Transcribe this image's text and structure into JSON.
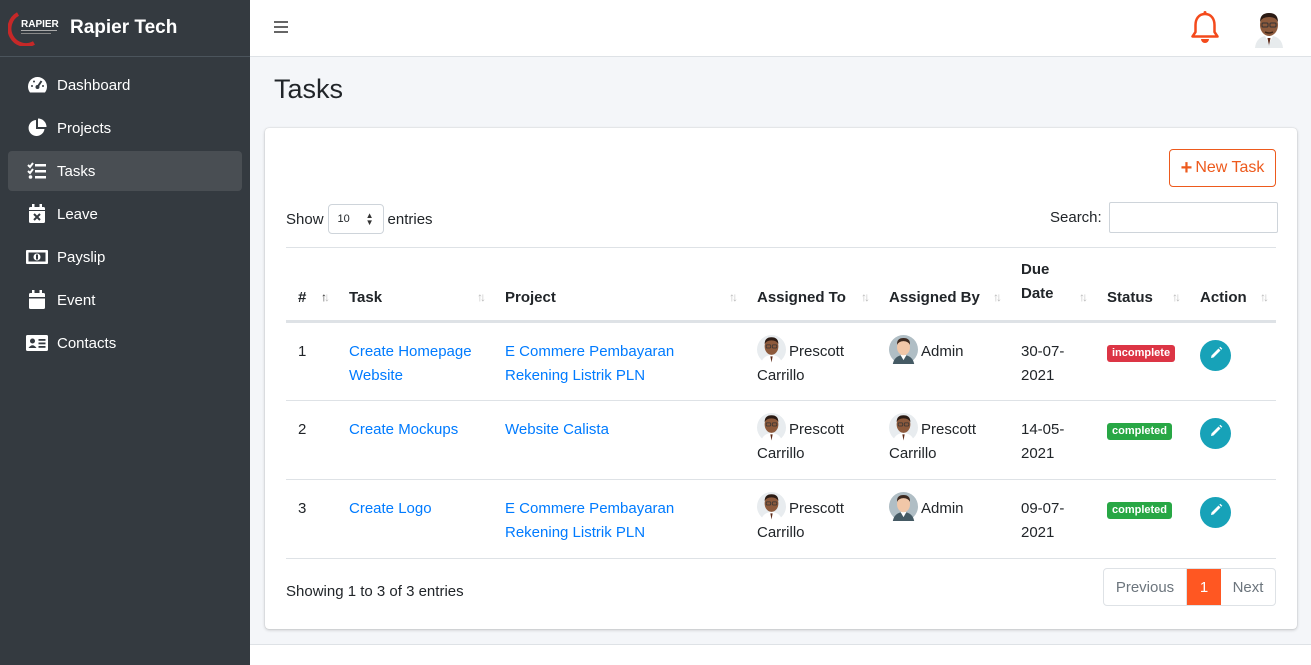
{
  "brand": {
    "name": "Rapier Tech",
    "logo_text": "RAPIER"
  },
  "sidebar": {
    "items": [
      {
        "label": "Dashboard",
        "icon": "tachometer-icon"
      },
      {
        "label": "Projects",
        "icon": "pie-chart-icon"
      },
      {
        "label": "Tasks",
        "icon": "tasks-icon",
        "active": true
      },
      {
        "label": "Leave",
        "icon": "calendar-times-icon"
      },
      {
        "label": "Payslip",
        "icon": "money-bill-icon"
      },
      {
        "label": "Event",
        "icon": "calendar-icon"
      },
      {
        "label": "Contacts",
        "icon": "address-card-icon"
      }
    ]
  },
  "header": {
    "menu_icon": "hamburger-icon",
    "notification_icon": "bell-icon"
  },
  "page": {
    "title": "Tasks"
  },
  "toolbar": {
    "new_task_label": "New Task"
  },
  "table_controls": {
    "show_label": "Show",
    "entries_value": "10",
    "entries_label": "entries",
    "search_label": "Search:"
  },
  "table": {
    "columns": [
      "#",
      "Task",
      "Project",
      "Assigned To",
      "Assigned By",
      "Due Date",
      "Status",
      "Action"
    ],
    "rows": [
      {
        "num": "1",
        "task": "Create Homepage Website",
        "project": "E Commere Pembayaran Rekening Listrik PLN",
        "assigned_to": "Prescott Carrillo",
        "assigned_by": "Admin",
        "due": "30-07-2021",
        "status": "incomplete"
      },
      {
        "num": "2",
        "task": "Create Mockups",
        "project": "Website Calista",
        "assigned_to": "Prescott Carrillo",
        "assigned_by": "Prescott Carrillo",
        "due": "14-05-2021",
        "status": "completed"
      },
      {
        "num": "3",
        "task": "Create Logo",
        "project": "E Commere Pembayaran Rekening Listrik PLN",
        "assigned_to": "Prescott Carrillo",
        "assigned_by": "Admin",
        "due": "09-07-2021",
        "status": "completed"
      }
    ]
  },
  "footer_info": "Showing 1 to 3 of 3 entries",
  "pagination": {
    "previous": "Previous",
    "current": "1",
    "next": "Next"
  },
  "colors": {
    "accent": "#ed5a1d",
    "sidebar": "#343a40",
    "link": "#007bff",
    "incomplete": "#dc3545",
    "completed": "#28a745",
    "edit": "#17a2b8"
  }
}
